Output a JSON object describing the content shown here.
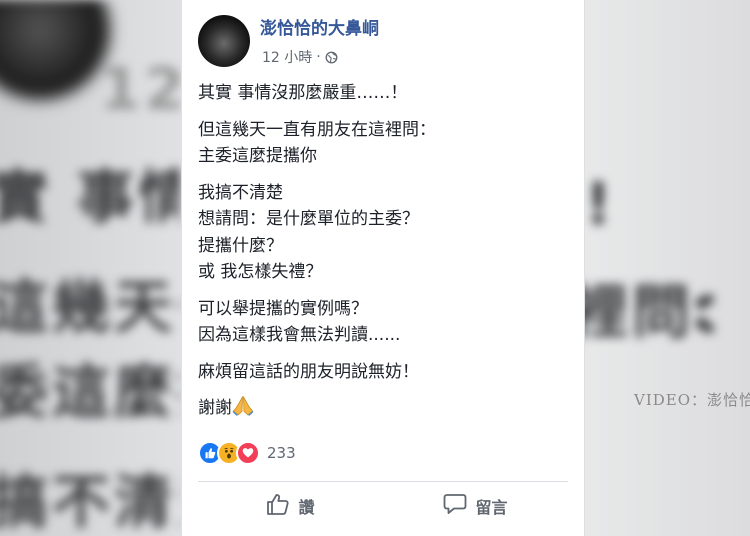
{
  "background": {
    "lines": [
      "12",
      "實 事情",
      "這幾天一",
      "委這麼提",
      "搞不清楚"
    ],
    "right_lines": [
      "!",
      "裡問：",
      ":"
    ],
    "watermark": "VIDEO：澎恰恰"
  },
  "post": {
    "page_name": "澎恰恰的大鼻峒",
    "time": "12 小時",
    "separator": "·",
    "privacy_icon": "globe-icon",
    "paragraphs": [
      [
        "其實 事情沒那麼嚴重……！"
      ],
      [
        "但這幾天一直有朋友在這裡問：",
        "主委這麼提攜你"
      ],
      [
        "我搞不清楚",
        "想請問：是什麼單位的主委？",
        "提攜什麼？",
        "或 我怎樣失禮？"
      ],
      [
        "可以舉提攜的實例嗎？",
        "因為這樣我會無法判讀......"
      ],
      [
        "麻煩留這話的朋友明說無妨！"
      ]
    ],
    "closing": "謝謝",
    "closing_emoji": "pray-emoji-icon"
  },
  "reactions": {
    "icons": [
      "like-reaction-icon",
      "wow-reaction-icon",
      "love-reaction-icon"
    ],
    "count": "233",
    "colors": {
      "like": "#1877f2",
      "wow": "#f7b125",
      "love": "#f33e58"
    }
  },
  "actions": {
    "like_label": "讚",
    "comment_label": "留言"
  },
  "colors": {
    "link": "#365899",
    "meta": "#616770",
    "text": "#1d2129"
  }
}
